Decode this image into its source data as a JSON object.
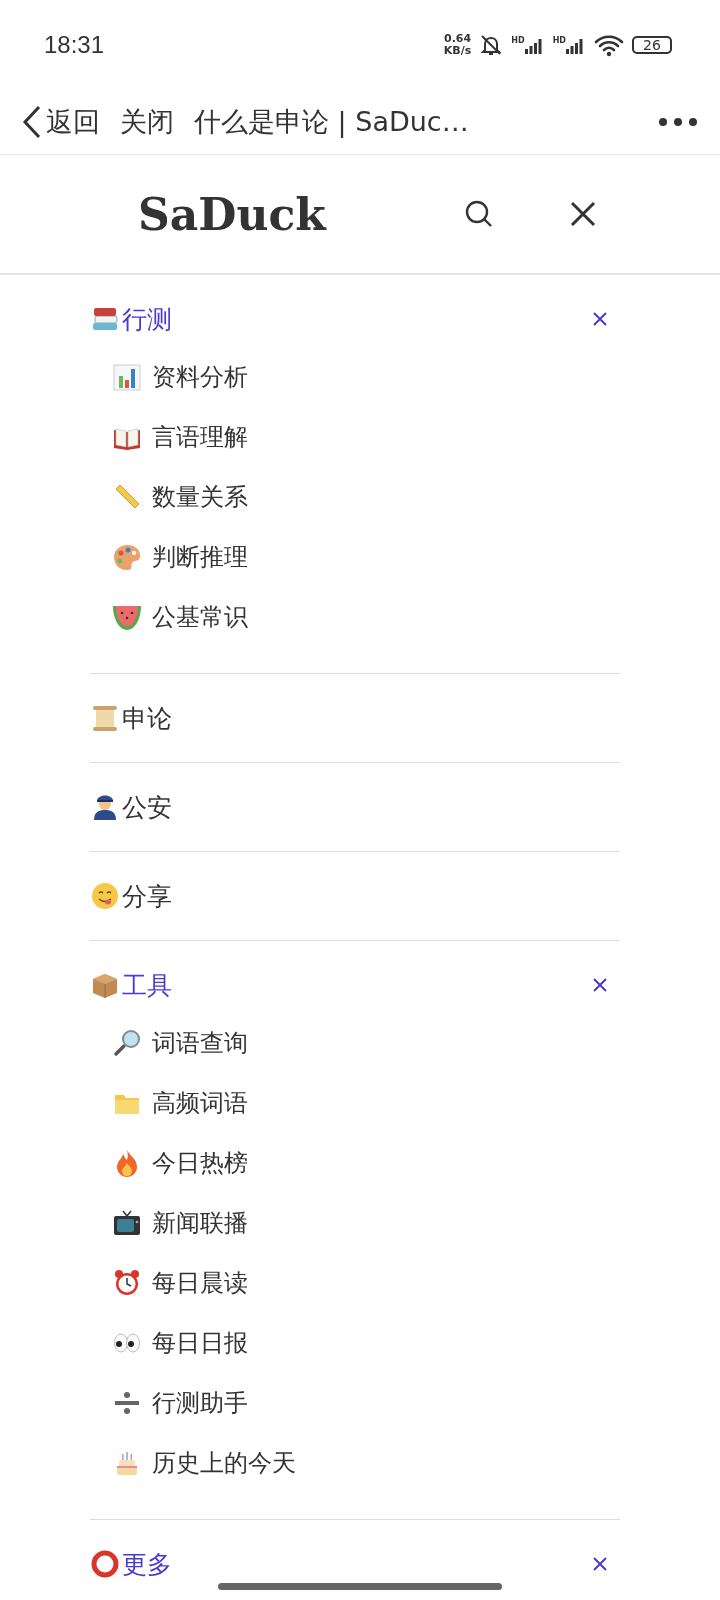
{
  "status_bar": {
    "time": "18:31",
    "speed_value": "0.64",
    "speed_unit": "KB/s",
    "signal_labels": [
      "HD",
      "HD"
    ],
    "battery": "26"
  },
  "title_bar": {
    "back": "返回",
    "close": "关闭",
    "title": "什么是申论 | SaDuc…"
  },
  "site_header": {
    "logo": "SaDuck"
  },
  "menu": [
    {
      "label": "行测",
      "kind": "books",
      "expanded": true,
      "children": [
        {
          "label": "资料分析",
          "kind": "chart"
        },
        {
          "label": "言语理解",
          "kind": "book"
        },
        {
          "label": "数量关系",
          "kind": "ruler"
        },
        {
          "label": "判断推理",
          "kind": "palette"
        },
        {
          "label": "公基常识",
          "kind": "watermelon"
        }
      ]
    },
    {
      "label": "申论",
      "kind": "scroll",
      "expanded": false
    },
    {
      "label": "公安",
      "kind": "police",
      "expanded": false
    },
    {
      "label": "分享",
      "kind": "yum",
      "expanded": false
    },
    {
      "label": "工具",
      "kind": "package",
      "expanded": true,
      "children": [
        {
          "label": "词语查询",
          "kind": "magnifier"
        },
        {
          "label": "高频词语",
          "kind": "folder"
        },
        {
          "label": "今日热榜",
          "kind": "fire"
        },
        {
          "label": "新闻联播",
          "kind": "tv"
        },
        {
          "label": "每日晨读",
          "kind": "alarm"
        },
        {
          "label": "每日日报",
          "kind": "eyes"
        },
        {
          "label": "行测助手",
          "kind": "divide"
        },
        {
          "label": "历史上的今天",
          "kind": "cake"
        }
      ]
    },
    {
      "label": "更多",
      "kind": "ring",
      "expanded": true
    }
  ]
}
